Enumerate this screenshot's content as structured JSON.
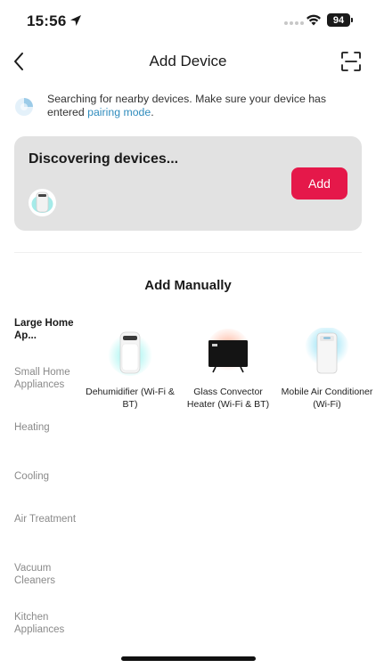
{
  "status_bar": {
    "time": "15:56",
    "battery_level": "94"
  },
  "header": {
    "title": "Add Device",
    "back_icon": "chevron-left-icon",
    "scan_icon": "scan-frame-icon"
  },
  "search_info": {
    "text_before_link": "Searching for nearby devices. Make sure your device has entered ",
    "link_text": "pairing mode",
    "text_after_link": "."
  },
  "discovering_card": {
    "title": "Discovering devices...",
    "add_label": "Add"
  },
  "manual_section": {
    "title": "Add Manually"
  },
  "categories": [
    {
      "label": "Large Home Ap...",
      "active": true
    },
    {
      "label": "Small Home Appliances",
      "active": false
    },
    {
      "label": "Heating",
      "active": false
    },
    {
      "label": "Cooling",
      "active": false
    },
    {
      "label": "Air Treatment",
      "active": false
    },
    {
      "label": "Vacuum Cleaners",
      "active": false
    },
    {
      "label": "Kitchen Appliances",
      "active": false
    }
  ],
  "devices": [
    {
      "label": "Dehumidifier (Wi-Fi & BT)",
      "icon": "dehumidifier-icon"
    },
    {
      "label": "Glass Convector Heater (Wi-Fi & BT)",
      "icon": "glass-convector-heater-icon"
    },
    {
      "label": "Mobile Air Conditioner (Wi-Fi)",
      "icon": "mobile-air-conditioner-icon"
    }
  ],
  "colors": {
    "accent_red": "#e5184a",
    "link_blue": "#2f8cbd",
    "card_gray": "#e2e2e2"
  }
}
